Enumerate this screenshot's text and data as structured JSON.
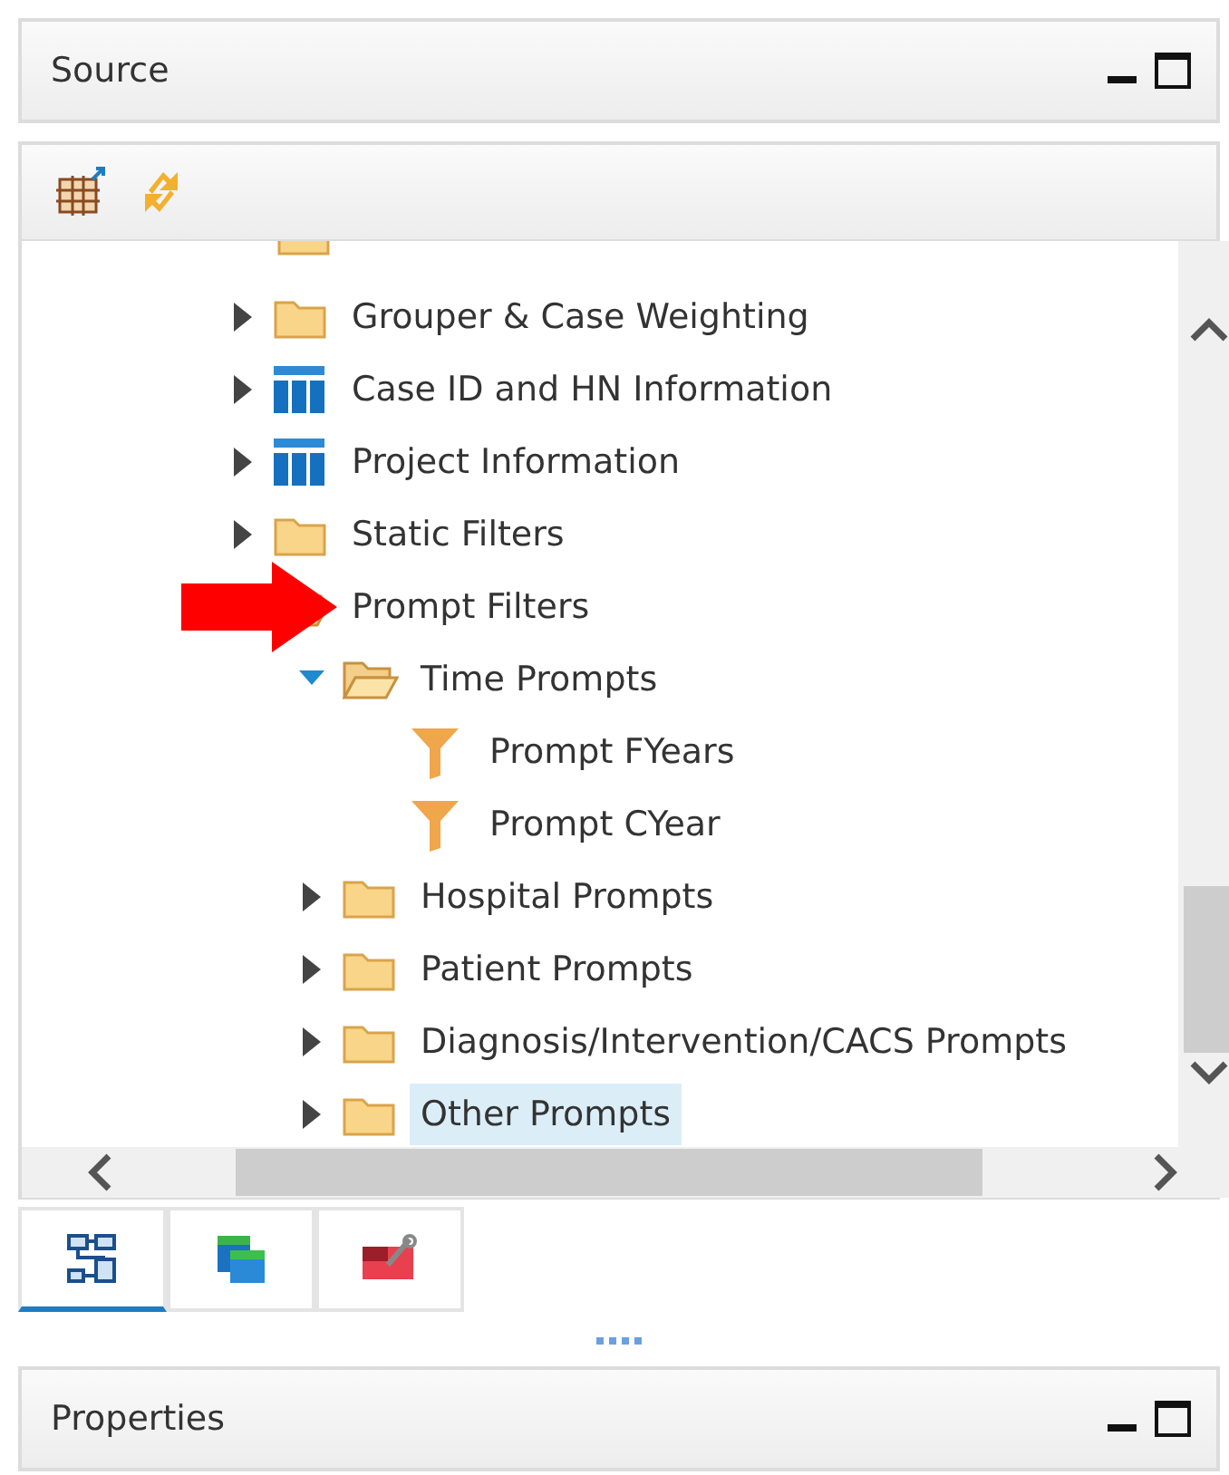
{
  "source_panel": {
    "title": "Source"
  },
  "properties_panel": {
    "title": "Properties"
  },
  "tree": [
    {
      "label": "Grouper & Case Weighting",
      "kind": "folder",
      "expanded": false,
      "selected": false
    },
    {
      "label": "Case ID and HN Information",
      "kind": "table",
      "expanded": false,
      "selected": false
    },
    {
      "label": "Project Information",
      "kind": "table",
      "expanded": false,
      "selected": false
    },
    {
      "label": "Static Filters",
      "kind": "folder",
      "expanded": false,
      "selected": false
    },
    {
      "label": "Prompt Filters",
      "kind": "folder",
      "expanded": true,
      "selected": false,
      "marked": true,
      "children": [
        {
          "label": "Time Prompts",
          "kind": "folder",
          "expanded": true,
          "selected": false,
          "children": [
            {
              "label": "Prompt FYears",
              "kind": "filter",
              "selected": false
            },
            {
              "label": "Prompt CYear",
              "kind": "filter",
              "selected": false
            }
          ]
        },
        {
          "label": "Hospital Prompts",
          "kind": "folder",
          "expanded": false,
          "selected": false
        },
        {
          "label": "Patient Prompts",
          "kind": "folder",
          "expanded": false,
          "selected": false
        },
        {
          "label": "Diagnosis/Intervention/CACS Prompts",
          "kind": "folder",
          "expanded": false,
          "selected": false
        },
        {
          "label": "Other Prompts",
          "kind": "folder",
          "expanded": false,
          "selected": true
        }
      ]
    }
  ],
  "tabs": [
    {
      "kind": "diagram",
      "selected": true
    },
    {
      "kind": "tables",
      "selected": false
    },
    {
      "kind": "tools",
      "selected": false
    }
  ]
}
